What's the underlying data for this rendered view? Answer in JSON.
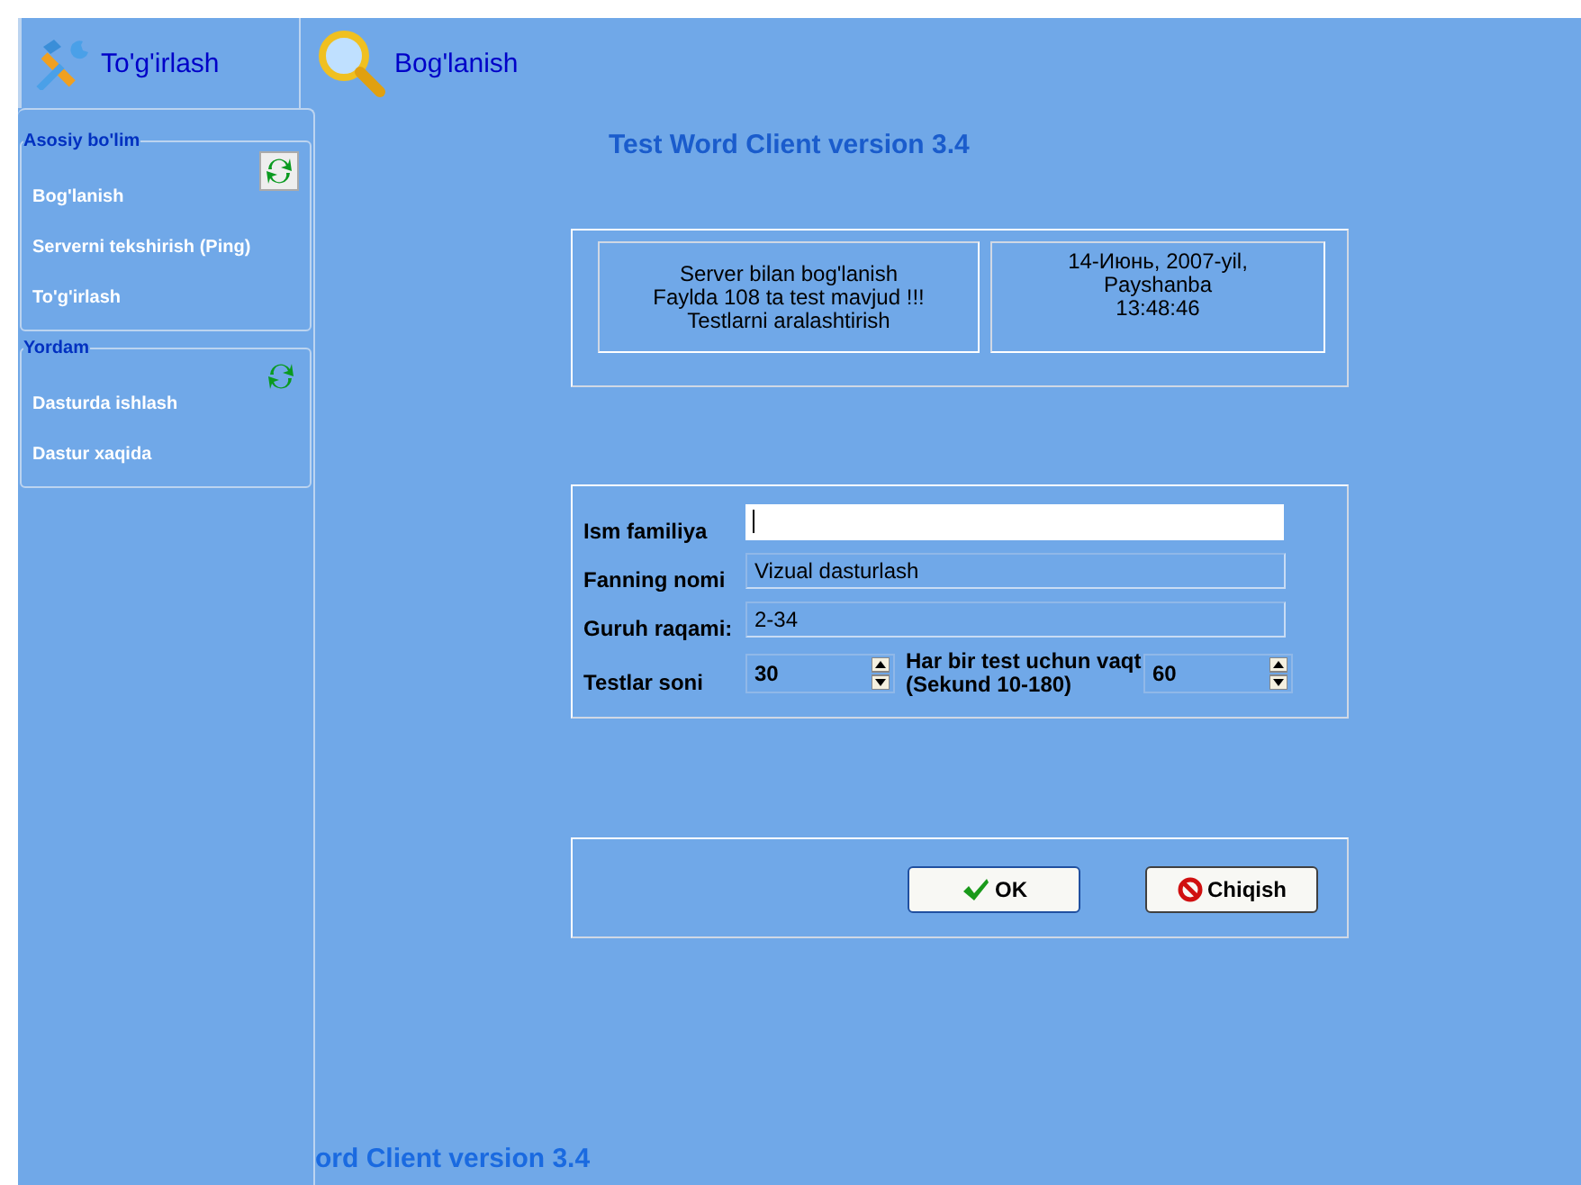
{
  "toolbar": [
    {
      "label": "To'g'irlash",
      "kind": "tools"
    },
    {
      "label": "Bog'lanish",
      "kind": "search"
    }
  ],
  "sidebar": {
    "groups": [
      {
        "title": "Asosiy bo'lim",
        "items": [
          "Bog'lanish",
          "Serverni tekshirish (Ping)",
          "To'g'irlash"
        ]
      },
      {
        "title": "Yordam",
        "items": [
          "Dasturda ishlash",
          "Dastur xaqida"
        ]
      }
    ]
  },
  "title": "Test Word Client version 3.4",
  "status": {
    "lines": [
      "Server bilan bog'lanish",
      "Faylda 108 ta test mavjud !!!",
      "Testlarni aralashtirish"
    ]
  },
  "datetime": {
    "lines": [
      "14-Июнь, 2007-yil,",
      "Payshanba",
      "13:48:46"
    ]
  },
  "form": {
    "name_label": "Ism familiya",
    "subject_label": "Fanning nomi",
    "subject_value": "Vizual dasturlash",
    "group_label": "Guruh raqami:",
    "group_value": "2-34",
    "count_label": "Testlar soni",
    "count_value": "30",
    "time_label": "Har bir test uchun vaqt (Sekund 10-180)",
    "time_value": "60"
  },
  "buttons": [
    {
      "label": "OK",
      "kind": "ok"
    },
    {
      "label": "Chiqish",
      "kind": "exit"
    }
  ],
  "marquee": "ord Client version 3.4"
}
